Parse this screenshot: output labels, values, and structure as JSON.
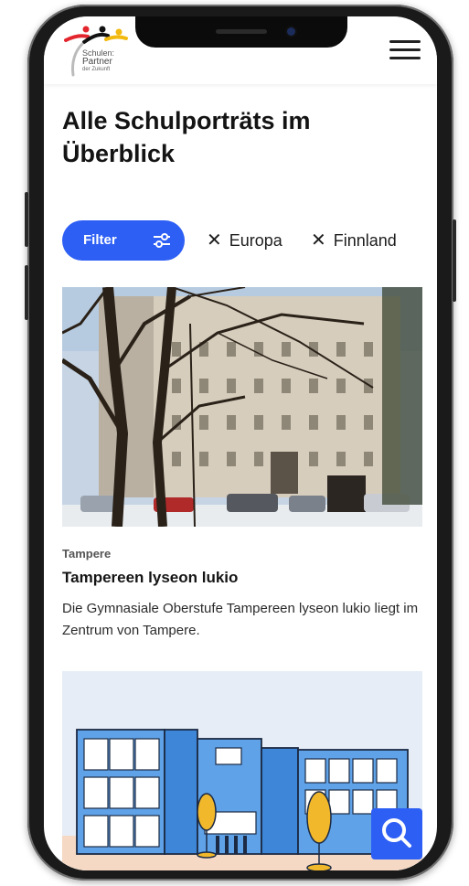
{
  "header": {
    "logo_line1": "Schulen:",
    "logo_line2": "Partner",
    "logo_line3": "der Zukunft",
    "menu_icon": "hamburger-menu-icon"
  },
  "page": {
    "title_line1": "Alle Schulporträts im",
    "title_line2": "Überblick"
  },
  "filters": {
    "filter_label": "Filter",
    "filter_icon": "sliders-icon",
    "chips": [
      {
        "label": "Europa"
      },
      {
        "label": "Finnland"
      }
    ],
    "remove_glyph": "✕"
  },
  "cards": [
    {
      "location": "Tampere",
      "title": "Tampereen lyseon lukio",
      "description": "Die Gymnasiale Oberstufe Tampereen lyseon lukio liegt im Zentrum von Tampere."
    }
  ],
  "search_icon": "search-icon",
  "colors": {
    "accent": "#2d5ff5",
    "text": "#141414"
  }
}
